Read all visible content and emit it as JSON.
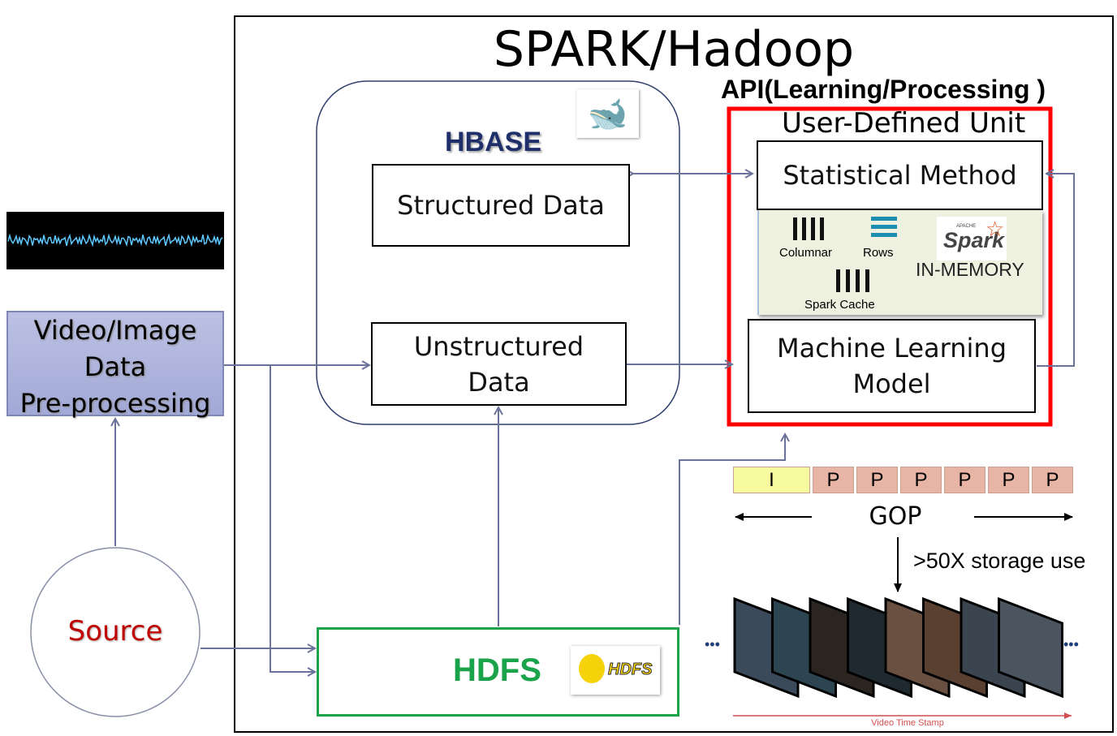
{
  "title": "SPARK/Hadoop",
  "hbase": {
    "label": "HBASE",
    "logo": "orca-icon",
    "structured": "Structured Data",
    "unstructured_line1": "Unstructured",
    "unstructured_line2": "Data"
  },
  "api": {
    "label": "API(Learning/Processing )",
    "unit_label": "User-Defined Unit",
    "statistical": "Statistical Method",
    "ml_line1": "Machine Learning",
    "ml_line2": "Model"
  },
  "spark_panel": {
    "columnar": "Columnar",
    "rows": "Rows",
    "cache": "Spark Cache",
    "in_memory": "IN-MEMORY",
    "logo_small": "APACHE",
    "logo": "Spark"
  },
  "preprocess": {
    "line1": "Video/Image",
    "line2": "Data",
    "line3": "Pre-processing"
  },
  "source": "Source",
  "hdfs": {
    "label": "HDFS",
    "logo": "HDFS"
  },
  "gop": {
    "frames": [
      "I",
      "P",
      "P",
      "P",
      "P",
      "P",
      "P"
    ],
    "label": "GOP",
    "storage": ">50X storage use"
  },
  "video": {
    "ellipsis_left": "•••",
    "ellipsis_right": "•••",
    "timestamp": "Video Time Stamp"
  },
  "colors": {
    "arrow": "#6b7299",
    "red": "#ff0000",
    "green": "#1aa34a",
    "navy": "#1f2f6a",
    "source_red": "#c00000",
    "i_frame": "#f7fa9f",
    "p_frame": "#e8b4a6"
  }
}
